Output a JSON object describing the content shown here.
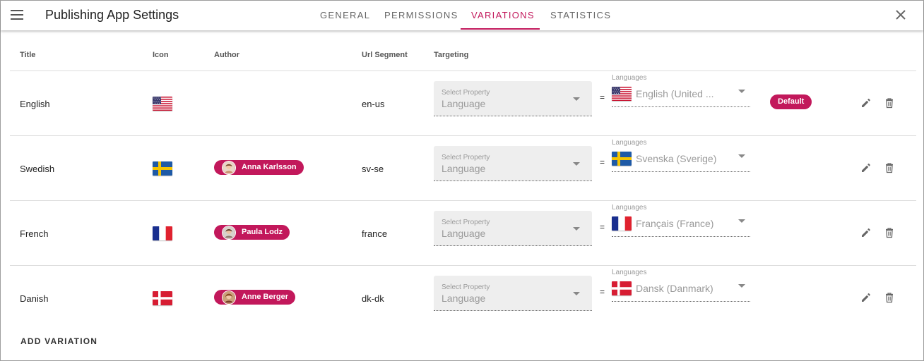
{
  "header": {
    "title": "Publishing App Settings",
    "tabs": [
      {
        "label": "GENERAL",
        "active": false
      },
      {
        "label": "PERMISSIONS",
        "active": false
      },
      {
        "label": "VARIATIONS",
        "active": true
      },
      {
        "label": "STATISTICS",
        "active": false
      }
    ]
  },
  "table": {
    "columns": [
      "Title",
      "Icon",
      "Author",
      "Url Segment",
      "Targeting"
    ],
    "rows": [
      {
        "title": "English",
        "flag": "us-flag",
        "author": "",
        "url_segment": "en-us",
        "select_label": "Select Property",
        "select_value": "Language",
        "equals": "=",
        "lang_label": "Languages",
        "lang_value": "English (United ...",
        "badge": "Default"
      },
      {
        "title": "Swedish",
        "flag": "se-flag",
        "author": "Anna Karlsson",
        "url_segment": "sv-se",
        "select_label": "Select Property",
        "select_value": "Language",
        "equals": "=",
        "lang_label": "Languages",
        "lang_value": "Svenska (Sverige)",
        "badge": ""
      },
      {
        "title": "French",
        "flag": "fr-flag",
        "author": "Paula Lodz",
        "url_segment": "france",
        "select_label": "Select Property",
        "select_value": "Language",
        "equals": "=",
        "lang_label": "Languages",
        "lang_value": "Français (France)",
        "badge": ""
      },
      {
        "title": "Danish",
        "flag": "dk-flag",
        "author": "Anne Berger",
        "url_segment": "dk-dk",
        "select_label": "Select Property",
        "select_value": "Language",
        "equals": "=",
        "lang_label": "Languages",
        "lang_value": "Dansk (Danmark)",
        "badge": ""
      }
    ]
  },
  "footer": {
    "add_label": "ADD VARIATION"
  },
  "colors": {
    "accent": "#c2185b",
    "select_bg": "#eeeeee",
    "muted_text": "#9a9a9a"
  },
  "icons": [
    "menu-icon",
    "close-icon",
    "edit-icon",
    "delete-icon",
    "dropdown-caret-icon"
  ]
}
